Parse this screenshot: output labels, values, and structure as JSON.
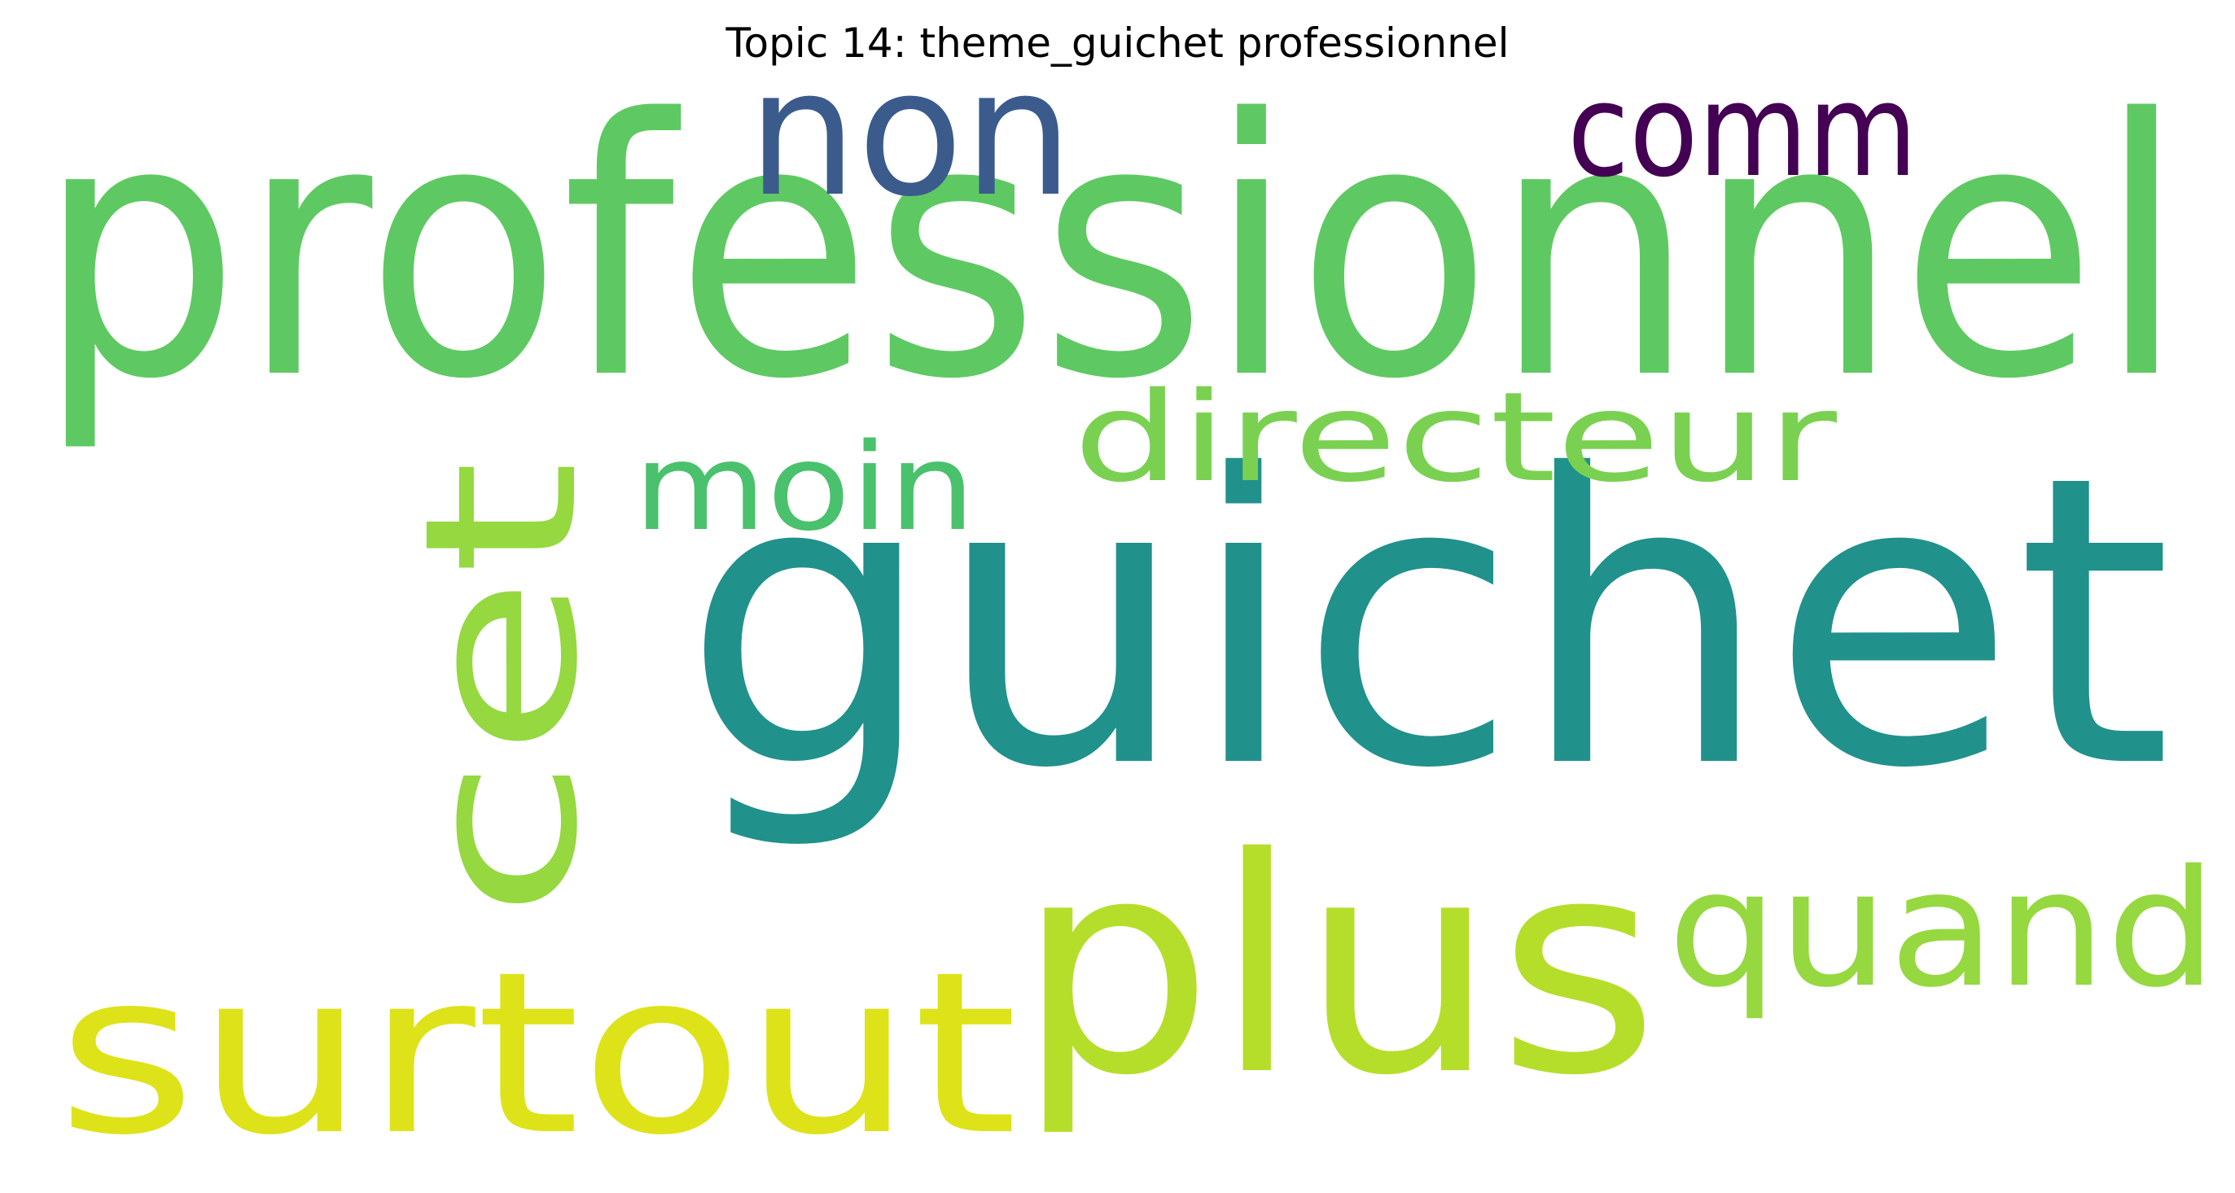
{
  "title": "Topic 14: theme_guichet professionnel",
  "words": [
    {
      "text": "professionnel",
      "color": "#5ec962"
    },
    {
      "text": "guichet",
      "color": "#21918c"
    },
    {
      "text": "plus",
      "color": "#b5de2b"
    },
    {
      "text": "cet",
      "color": "#95d840"
    },
    {
      "text": "surtout",
      "color": "#dde318"
    },
    {
      "text": "non",
      "color": "#3b5b8d"
    },
    {
      "text": "quand",
      "color": "#95d840"
    },
    {
      "text": "comm",
      "color": "#440154"
    },
    {
      "text": "directeur",
      "color": "#7ad151"
    },
    {
      "text": "moin",
      "color": "#4ac16d"
    }
  ]
}
